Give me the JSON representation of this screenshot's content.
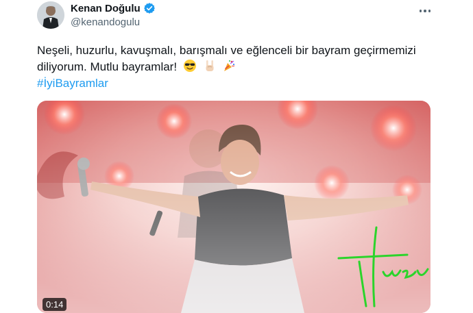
{
  "tweet": {
    "author": {
      "display_name": "Kenan Doğulu",
      "handle": "@kenandogulu",
      "verified": true
    },
    "text_line1": "Neşeli, huzurlu, kavuşmalı, barışmalı ve eğlenceli bir bayram geçirmemizi",
    "text_line2": "diliyorum. Mutlu bayramlar!",
    "emojis": [
      "smiling-face-with-sunglasses-icon",
      "sign-of-horns-icon",
      "party-popper-icon"
    ],
    "hashtag": "#İyiBayramlar",
    "media": {
      "type": "video",
      "duration": "0:14",
      "overlay_text": "Huzur"
    }
  },
  "colors": {
    "link": "#1d9bf0",
    "verified_badge": "#1d9bf0",
    "secondary_text": "#536471",
    "signature": "#2bd42b"
  }
}
